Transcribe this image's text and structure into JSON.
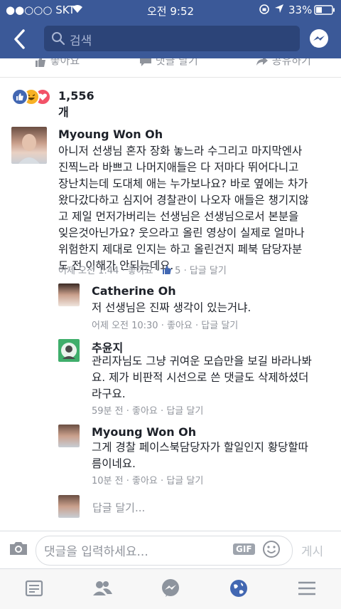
{
  "status": {
    "carrier": "●●○○○ SKT",
    "time": "오전 9:52",
    "battery": "33%"
  },
  "nav": {
    "search_placeholder": "검색"
  },
  "post_actions": {
    "like": "좋아요",
    "comment": "댓글 달기",
    "share": "공유하기"
  },
  "reactions": {
    "count": "1,556개",
    "types": [
      "like",
      "haha",
      "love"
    ]
  },
  "comments": [
    {
      "name": "Myoung Won Oh",
      "lines": [
        "아니저 선생님 혼자 장화 놓느라 수그리고 마지막엔사",
        "진찍느라 바쁘고 나머지애들은 다 저마다 뛰어다니고",
        "장난치는데 도대체 애는 누가보나요? 바로 옆에는 차가",
        "왔다갔다하고 심지어 경찰관이 나오자 애들은 챙기지않",
        "고 제일 먼저가버리는 선생님은 선생님으로서 본분을",
        "잊은것아닌가요? 웃으라고 올린 영상이 실제로 얼마나",
        "위험한지 제대로 인지는 하고 올린건지 페북 담당자분",
        "도 전 이해가 안되는데요."
      ],
      "time": "어제 오전 1:44",
      "like": "좋아요",
      "like_count": "5",
      "reply": "답글 달기"
    }
  ],
  "replies": [
    {
      "name": "Catherine Oh",
      "lines": [
        "저 선생님은 진짜 생각이 있는거냐."
      ],
      "time": "어제 오전 10:30",
      "like": "좋아요",
      "reply": "답글 달기"
    },
    {
      "name": "추윤지",
      "lines": [
        "관리자님도 그냥 귀여운 모습만을 보길 바라나봐",
        "요. 제가 비판적 시선으로 쓴 댓글도 삭제하셨더",
        "라구요."
      ],
      "time": "59분 전",
      "like": "좋아요",
      "reply": "답글 달기"
    },
    {
      "name": "Myoung Won Oh",
      "lines": [
        "그게 경찰 페이스북담당자가 할일인지 황당할따",
        "름이네요."
      ],
      "time": "10분 전",
      "like": "좋아요",
      "reply": "답글 달기"
    }
  ],
  "reply_placeholder": "답글 달기...",
  "composer": {
    "placeholder": "댓글을 입력하세요...",
    "gif": "GIF",
    "send": "게시"
  },
  "tabs": [
    "news-feed",
    "friends",
    "messenger",
    "notifications",
    "more"
  ],
  "colors": {
    "brand": "#3b5998",
    "like_blue": "#4267b2",
    "meta_gray": "#90949c"
  }
}
